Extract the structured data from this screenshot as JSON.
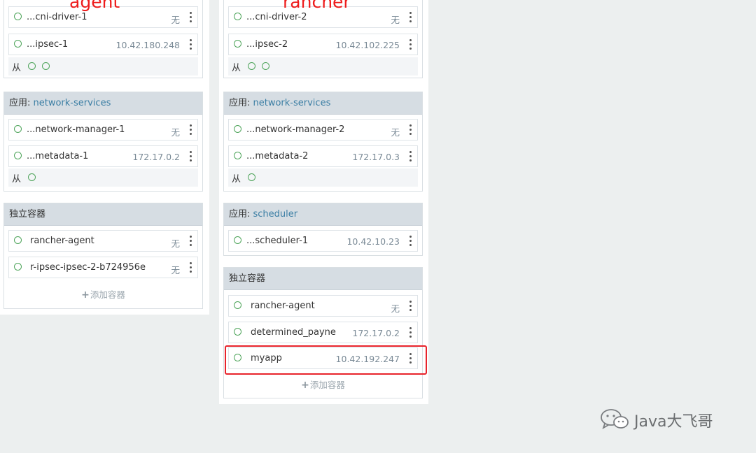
{
  "annotations": {
    "left": "agent",
    "right": "rancher"
  },
  "agent": {
    "ipsec_card": {
      "rows": [
        {
          "name": "...cni-driver-1",
          "value": "无"
        },
        {
          "name": "...ipsec-1",
          "value": "10.42.180.248"
        }
      ],
      "footer_label": "从"
    },
    "network_card": {
      "prefix": "应用: ",
      "app": "network-services",
      "rows": [
        {
          "name": "...network-manager-1",
          "value": "无"
        },
        {
          "name": "...metadata-1",
          "value": "172.17.0.2"
        }
      ],
      "footer_label": "从"
    },
    "standalone_card": {
      "title": "独立容器",
      "rows": [
        {
          "name": "rancher-agent",
          "value": "无"
        },
        {
          "name": "r-ipsec-ipsec-2-b724956e",
          "value": "无"
        }
      ],
      "add_label": "添加容器"
    }
  },
  "rancher": {
    "ipsec_card": {
      "rows": [
        {
          "name": "...cni-driver-2",
          "value": "无"
        },
        {
          "name": "...ipsec-2",
          "value": "10.42.102.225"
        }
      ],
      "footer_label": "从"
    },
    "network_card": {
      "prefix": "应用: ",
      "app": "network-services",
      "rows": [
        {
          "name": "...network-manager-2",
          "value": "无"
        },
        {
          "name": "...metadata-2",
          "value": "172.17.0.3"
        }
      ],
      "footer_label": "从"
    },
    "scheduler_card": {
      "prefix": "应用: ",
      "app": "scheduler",
      "rows": [
        {
          "name": "...scheduler-1",
          "value": "10.42.10.23"
        }
      ]
    },
    "standalone_card": {
      "title": "独立容器",
      "rows": [
        {
          "name": "rancher-agent",
          "value": "无"
        },
        {
          "name": "determined_payne",
          "value": "172.17.0.2"
        },
        {
          "name": "myapp",
          "value": "10.42.192.247"
        }
      ],
      "add_label": "添加容器"
    }
  },
  "watermark": {
    "text": "Java大飞哥"
  },
  "colors": {
    "status_green": "#4ea45a",
    "link": "#3b7ea4",
    "highlight_red": "#e8232b",
    "header_bg": "#d6dde3"
  }
}
